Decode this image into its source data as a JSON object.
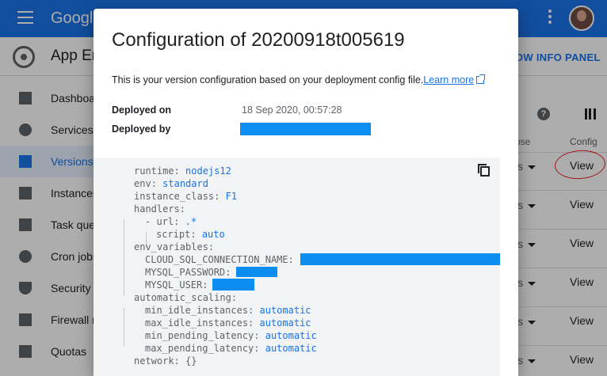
{
  "topbar": {
    "brand": "Google"
  },
  "subbar": {
    "title": "App En",
    "info_panel": "OW INFO PANEL"
  },
  "sidebar": {
    "items": [
      {
        "label": "Dashboar",
        "icon": "dashboard-icon"
      },
      {
        "label": "Services",
        "icon": "services-icon"
      },
      {
        "label": "Versions",
        "icon": "versions-icon",
        "active": true
      },
      {
        "label": "Instances",
        "icon": "instances-icon"
      },
      {
        "label": "Task que",
        "icon": "task-queues-icon"
      },
      {
        "label": "Cron jobs",
        "icon": "cron-jobs-icon"
      },
      {
        "label": "Security s",
        "icon": "security-icon"
      },
      {
        "label": "Firewall r",
        "icon": "firewall-icon"
      },
      {
        "label": "Quotas",
        "icon": "quotas-icon"
      }
    ]
  },
  "table": {
    "col_diagnose": "ose",
    "col_config": "Config",
    "row_diag_text": "ls",
    "view_label": "View"
  },
  "dialog": {
    "title": "Configuration of 20200918t005619",
    "description": "This is your version configuration based on your deployment config file.",
    "learn_more": "Learn more",
    "deployed_on_label": "Deployed on",
    "deployed_on_value": "18 Sep 2020, 00:57:28",
    "deployed_by_label": "Deployed by",
    "code": {
      "runtime_key": "runtime",
      "runtime_val": "nodejs12",
      "env_key": "env",
      "env_val": "standard",
      "instance_class_key": "instance_class",
      "instance_class_val": "F1",
      "handlers_key": "handlers",
      "url_key": "url",
      "url_val": ".*",
      "script_key": "script",
      "script_val": "auto",
      "env_variables_key": "env_variables",
      "cloud_sql_key": "CLOUD_SQL_CONNECTION_NAME",
      "mysql_password_key": "MYSQL_PASSWORD",
      "mysql_user_key": "MYSQL_USER",
      "automatic_scaling_key": "automatic_scaling",
      "min_idle_key": "min_idle_instances",
      "min_idle_val": "automatic",
      "max_idle_key": "max_idle_instances",
      "max_idle_val": "automatic",
      "min_pending_key": "min_pending_latency",
      "min_pending_val": "automatic",
      "max_pending_key": "max_pending_latency",
      "max_pending_val": "automatic",
      "network_key": "network",
      "network_val": "{}"
    }
  },
  "colors": {
    "accent": "#1a73e8",
    "redaction": "#0b8ef0",
    "annotation": "#e8202a"
  }
}
